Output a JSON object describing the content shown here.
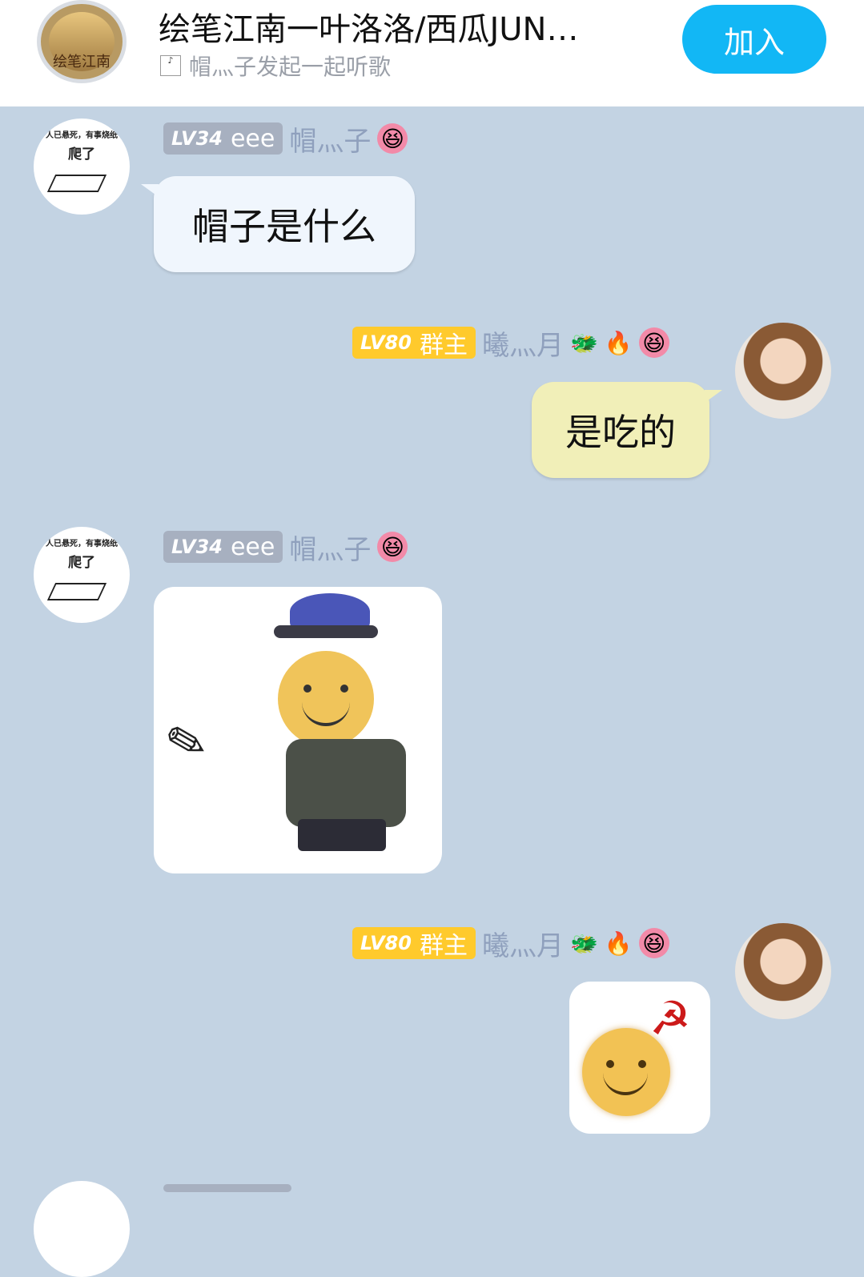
{
  "header": {
    "group_name": "绘笔江南一叶洛洛/西瓜JUN…",
    "avatar_caption": "绘笔江南",
    "subtitle": "帽灬子发起一起听歌",
    "join_label": "加入"
  },
  "left_avatar": {
    "line1": "人已悬死，有事烧纸",
    "line2": "爬了"
  },
  "messages": [
    {
      "side": "left",
      "level": "LV34",
      "title": "eee",
      "nick": "帽灬子",
      "icons": [
        "flower-emoji-icon"
      ],
      "type": "text",
      "text": "帽子是什么"
    },
    {
      "side": "right",
      "level": "LV80",
      "title": "群主",
      "nick": "曦灬月",
      "icons": [
        "dragon-icon",
        "fire-icon",
        "flower-emoji-icon"
      ],
      "type": "text",
      "text": "是吃的"
    },
    {
      "side": "left",
      "level": "LV34",
      "title": "eee",
      "nick": "帽灬子",
      "icons": [
        "flower-emoji-icon"
      ],
      "type": "sticker",
      "sticker": "soldier-salute-sticker"
    },
    {
      "side": "right",
      "level": "LV80",
      "title": "群主",
      "nick": "曦灬月",
      "icons": [
        "dragon-icon",
        "fire-icon",
        "flower-emoji-icon"
      ],
      "type": "sticker",
      "sticker": "smiley-hammer-sickle-sticker"
    }
  ],
  "colors": {
    "chat_background": "#c3d3e3",
    "join_button": "#12b7f5",
    "admin_badge": "#ffca2c",
    "member_badge": "#a7b0c0",
    "outgoing_bubble": "#f1efb8",
    "incoming_bubble": "#f0f6fd"
  },
  "glyphs": {
    "flower": "😆",
    "dragon": "🐲",
    "fire": "🔥",
    "note": "♪",
    "hammer": "☭"
  }
}
